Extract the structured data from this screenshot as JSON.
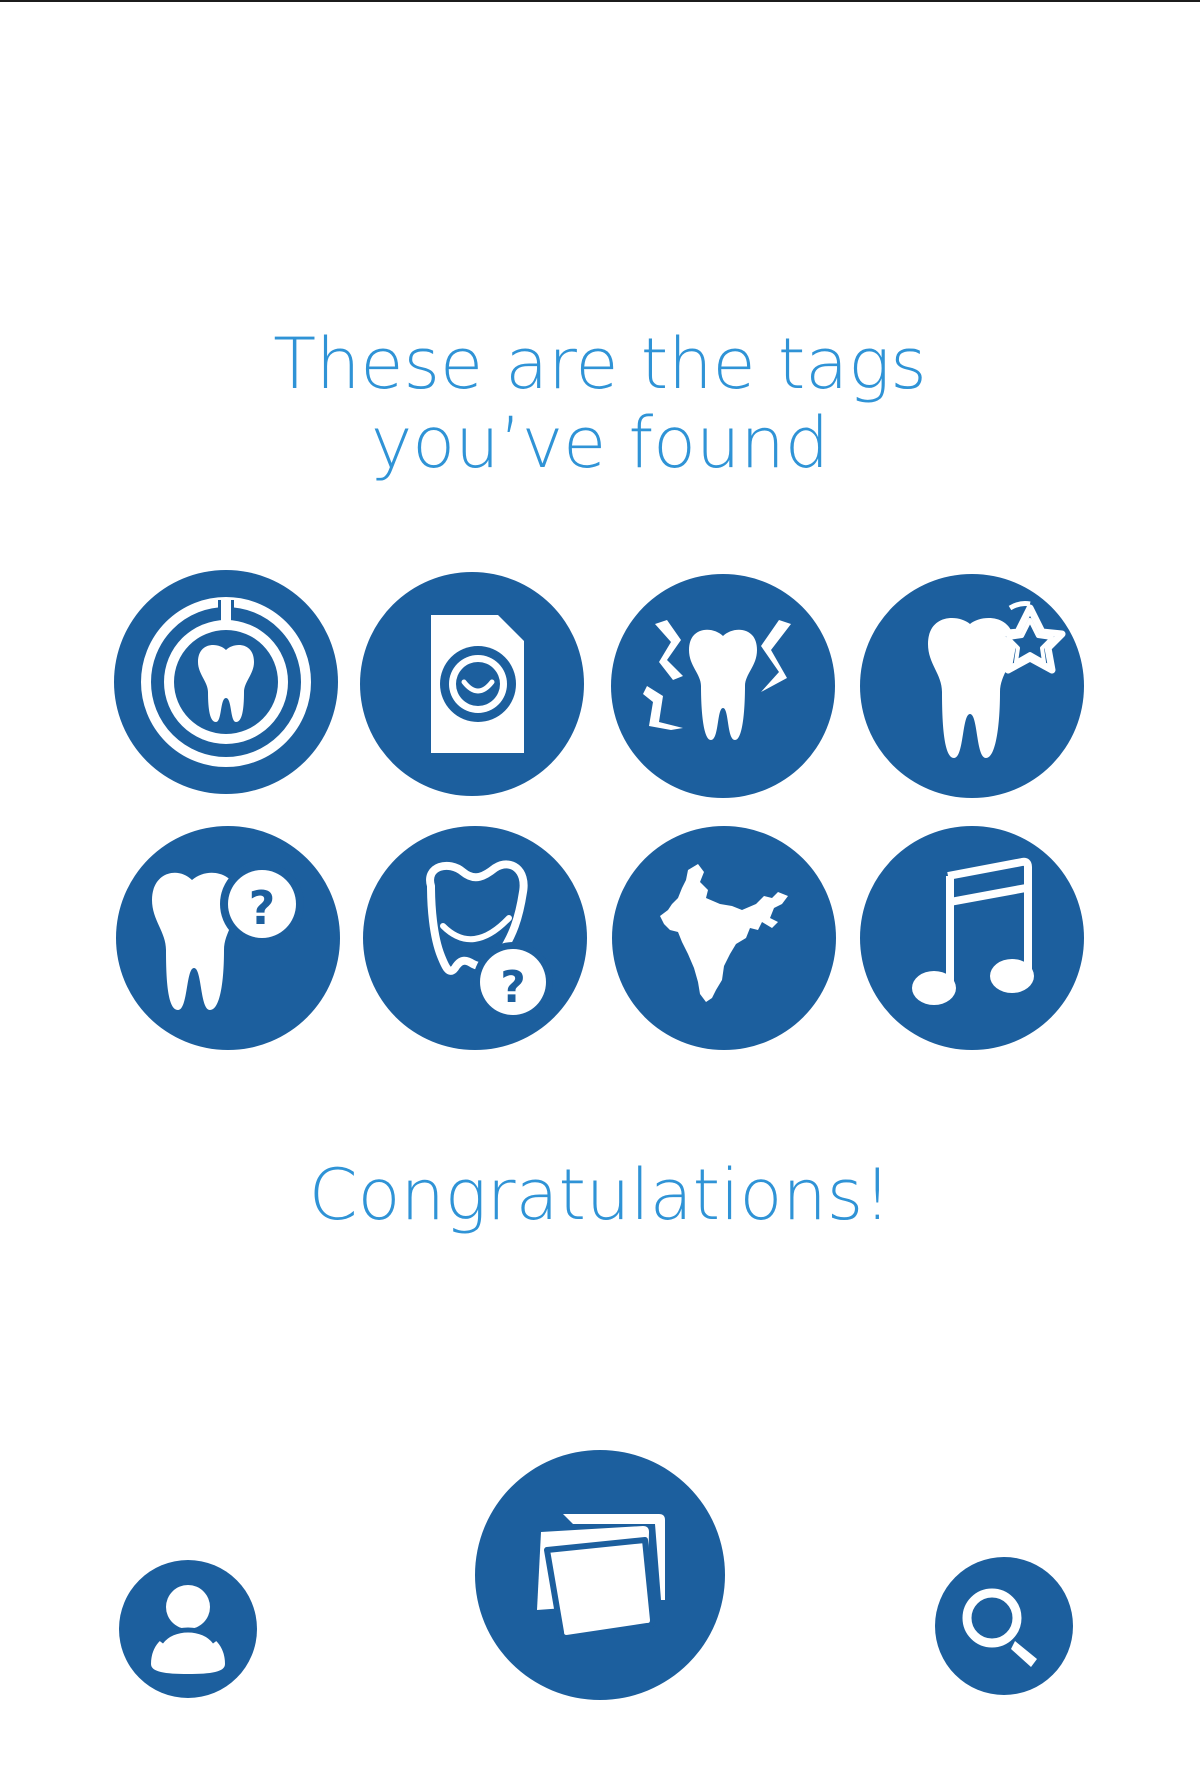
{
  "header": {
    "title_line1": "These are the tags",
    "title_line2": "you’ve found"
  },
  "tags": [
    {
      "icon": "dental-light-tooth-icon"
    },
    {
      "icon": "document-smile-icon"
    },
    {
      "icon": "tooth-pain-icon"
    },
    {
      "icon": "tooth-star-icon"
    },
    {
      "icon": "tooth-question-icon"
    },
    {
      "icon": "smile-question-icon"
    },
    {
      "icon": "india-map-icon"
    },
    {
      "icon": "music-note-icon"
    }
  ],
  "footer": {
    "message": "Congratulations!"
  },
  "bottom_nav": [
    {
      "icon": "user-icon"
    },
    {
      "icon": "cards-icon"
    },
    {
      "icon": "search-icon"
    }
  ],
  "colors": {
    "primary": "#1c5f9e",
    "heading": "#2f93d6",
    "background": "#ffffff"
  }
}
